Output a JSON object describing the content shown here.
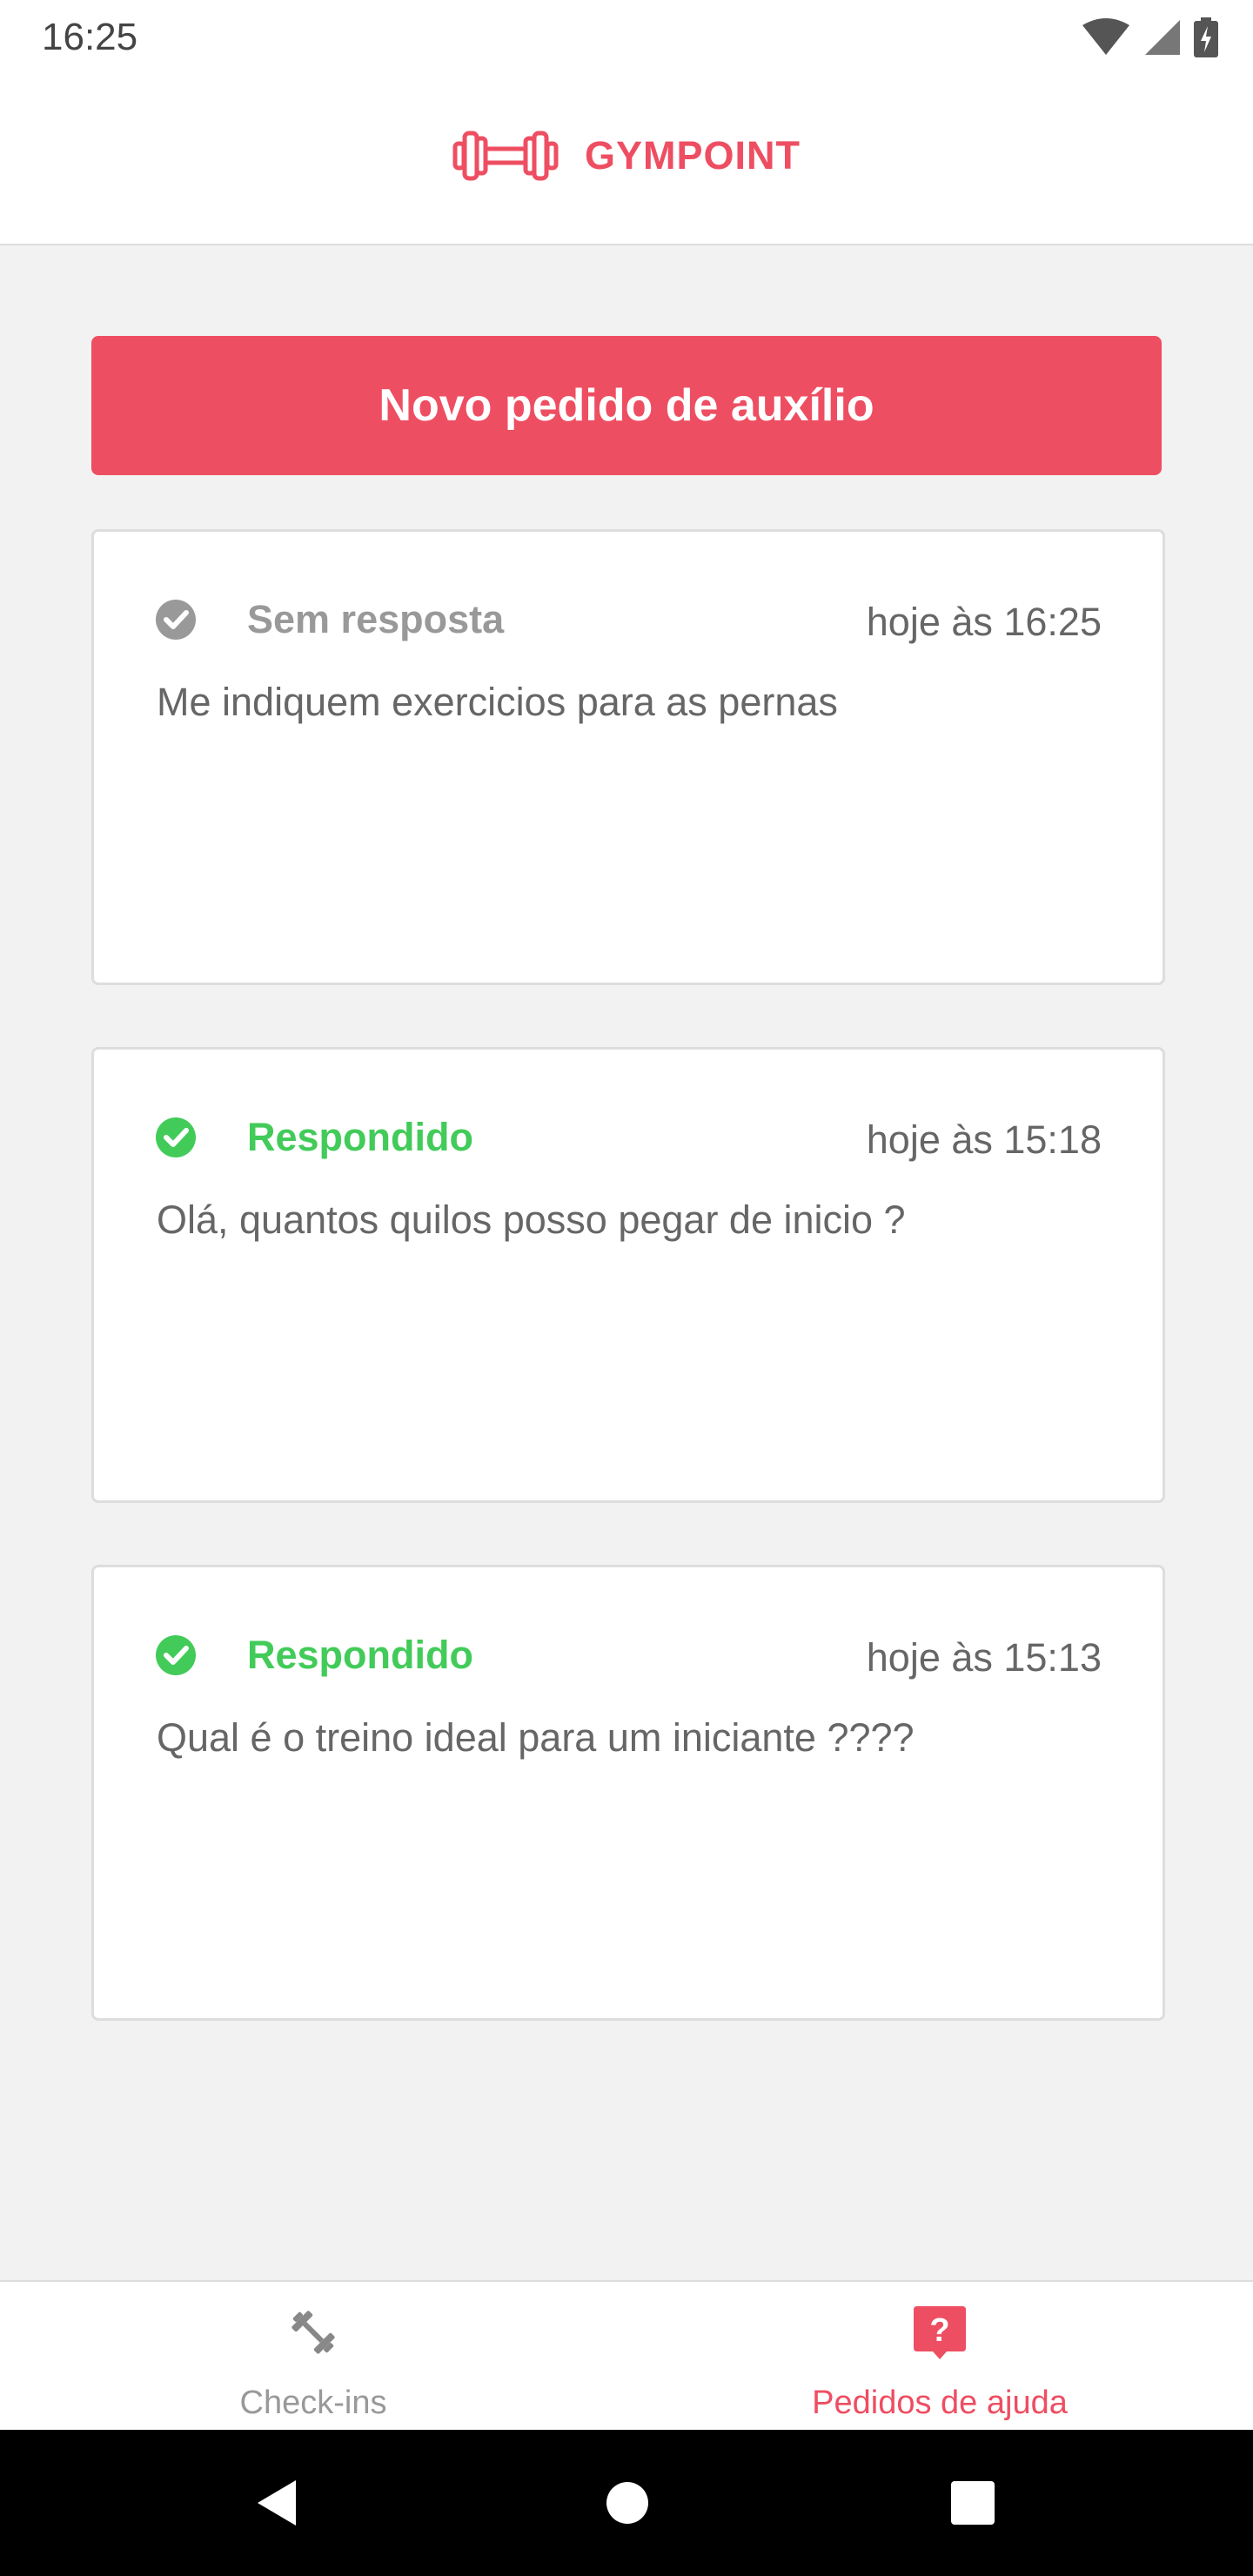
{
  "status_bar": {
    "time": "16:25",
    "icons": [
      "wifi-icon",
      "signal-icon",
      "battery-icon"
    ]
  },
  "header": {
    "brand": "GYMPOINT",
    "logo_icon": "dumbbell-icon",
    "accent": "#ee4e62"
  },
  "main": {
    "new_request_label": "Novo pedido de auxílio",
    "requests": [
      {
        "status": "Sem resposta",
        "status_color": "#999999",
        "time": "hoje às 16:25",
        "question": "Me indiquem exercicios para as pernas"
      },
      {
        "status": "Respondido",
        "status_color": "#42cb59",
        "time": "hoje às 15:18",
        "question": "Olá, quantos quilos posso pegar de inicio ?"
      },
      {
        "status": "Respondido",
        "status_color": "#42cb59",
        "time": "hoje às 15:13",
        "question": "Qual é o treino ideal para um iniciante ????"
      }
    ]
  },
  "tabs": [
    {
      "label": "Check-ins",
      "icon": "dumbbell-icon",
      "active": false
    },
    {
      "label": "Pedidos de ajuda",
      "icon": "help-bubble-icon",
      "active": true
    }
  ],
  "system_nav": {
    "buttons": [
      "back-icon",
      "home-icon",
      "recents-icon"
    ]
  }
}
